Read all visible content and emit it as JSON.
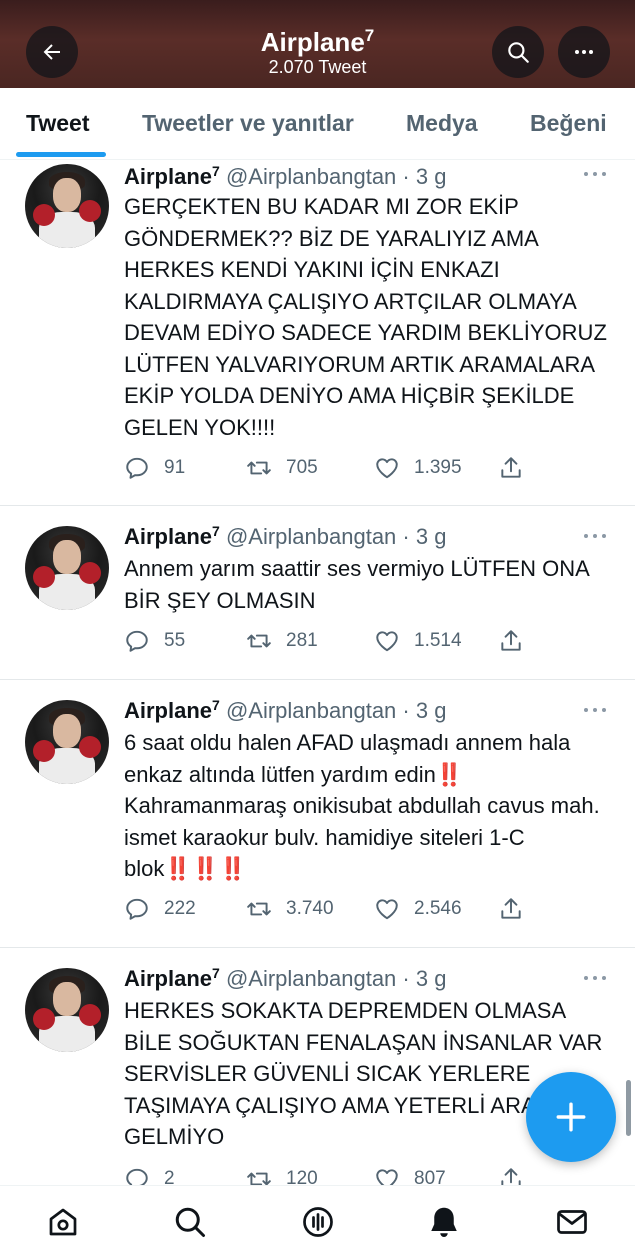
{
  "header": {
    "title": "Airplane",
    "title_sup": "7",
    "tweet_count": "2.070 Tweet"
  },
  "tabs": [
    {
      "label": "Tweet",
      "active": true
    },
    {
      "label": "Tweetler ve yanıtlar",
      "active": false
    },
    {
      "label": "Medya",
      "active": false
    },
    {
      "label": "Beğeni",
      "active": false
    }
  ],
  "tweets": [
    {
      "name": "Airplane",
      "name_sup": "7",
      "handle": "@Airplanbangtan · 3 g",
      "text": "GERÇEKTEN BU KADAR MI ZOR EKİP GÖNDERMEK?? BİZ DE YARALIYIZ AMA HERKES KENDİ YAKINI İÇİN ENKAZI KALDIRMAYA ÇALIŞIYO ARTÇILAR OLMAYA DEVAM EDİYO SADECE YARDIM BEKLİYORUZ LÜTFEN YALVARIYORUM ARTIK ARAMALARA EKİP YOLDA DENİYO AMA HİÇBİR ŞEKİLDE GELEN YOK!!!!",
      "replies": "91",
      "retweets": "705",
      "likes": "1.395"
    },
    {
      "name": "Airplane",
      "name_sup": "7",
      "handle": "@Airplanbangtan · 3 g",
      "text": "Annem yarım saattir ses vermiyo LÜTFEN ONA BİR ŞEY OLMASIN",
      "replies": "55",
      "retweets": "281",
      "likes": "1.514"
    },
    {
      "name": "Airplane",
      "name_sup": "7",
      "handle": "@Airplanbangtan · 3 g",
      "text_part1": "6 saat oldu halen AFAD ulaşmadı annem hala enkaz altında lütfen yardım edin",
      "emoji_1": "‼️",
      "text_part2": "Kahramanmaraş onikisubat abdullah cavus mah. ismet karaokur bulv. hamidiye siteleri 1-C blok",
      "emoji_2": "‼️‼️‼️",
      "replies": "222",
      "retweets": "3.740",
      "likes": "2.546"
    },
    {
      "name": "Airplane",
      "name_sup": "7",
      "handle": "@Airplanbangtan · 3 g",
      "text": "HERKES SOKAKTA DEPREMDEN OLMASA BİLE SOĞUKTAN FENALAŞAN İNSANLAR VAR SERVİSLER GÜVENLİ SICAK YERLERE TAŞIMAYA ÇALIŞIYO AMA YETERLİ ARAÇ GELMİYO",
      "replies": "2",
      "retweets": "120",
      "likes": "807"
    }
  ],
  "icons": {
    "back": "arrow-left-icon",
    "search": "search-icon",
    "more": "more-horizontal-icon",
    "compose": "plus-icon",
    "home": "home-icon",
    "explore": "search-icon",
    "spaces": "microphone-icon",
    "notifications": "bell-icon",
    "messages": "envelope-icon"
  },
  "colors": {
    "accent": "#1d9bf0",
    "text": "#0f1419",
    "secondary": "#536471"
  }
}
